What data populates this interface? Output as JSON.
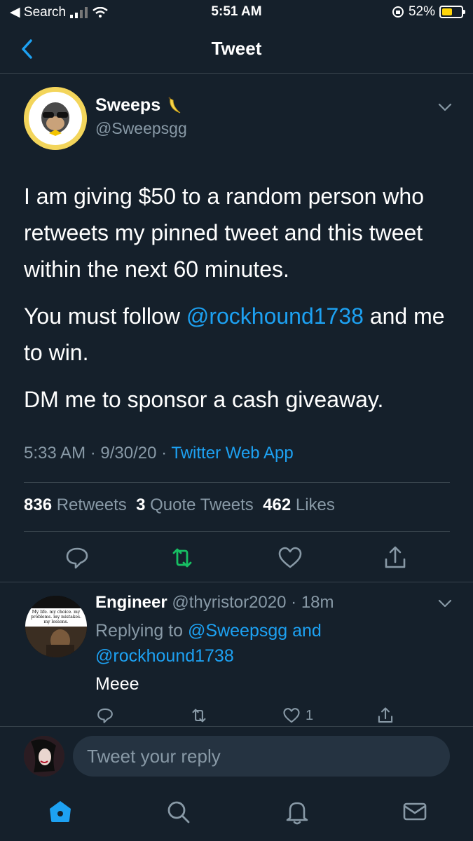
{
  "status_bar": {
    "back_app": "◀ Search",
    "time": "5:51 AM",
    "battery": "52%",
    "battery_level": 0.52
  },
  "nav": {
    "title": "Tweet"
  },
  "tweet": {
    "name": "Sweeps",
    "handle": "@Sweepsgg",
    "text_p1": "I am giving $50 to a random person who retweets my pinned tweet and this tweet within the next 60 minutes.",
    "text_p2_before": "You must follow ",
    "text_p2_mention": "@rockhound1738",
    "text_p2_after": " and me to win.",
    "text_p3": "DM me to sponsor a cash giveaway.",
    "time": "5:33 AM",
    "date": "9/30/20",
    "source": "Twitter Web App",
    "retweets_count": "836",
    "retweets_label": "Retweets",
    "quotes_count": "3",
    "quotes_label": "Quote Tweets",
    "likes_count": "462",
    "likes_label": "Likes"
  },
  "reply": {
    "name": "Engineer",
    "handle": "@thyristor2020",
    "time": "18m",
    "replying_prefix": "Replying to ",
    "replying_user1": "@Sweepsgg",
    "replying_and": " and ",
    "replying_user2": "@rockhound1738",
    "text": "Meee",
    "like_count": "1",
    "avatar_caption": "My life. my choice. my problems. my mistakes. my lessons."
  },
  "compose": {
    "placeholder": "Tweet your reply"
  },
  "colors": {
    "background": "#15202b",
    "accent": "#1da1f2",
    "retweet_green": "#17bf63",
    "secondary_text": "#8899a6",
    "divider": "#38444d"
  }
}
